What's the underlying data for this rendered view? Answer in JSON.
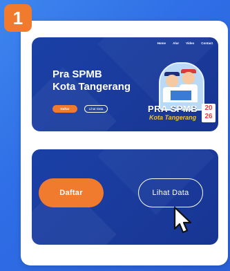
{
  "step": {
    "number": "1"
  },
  "colors": {
    "accent": "#f07a2d",
    "panel": "#1a40a6",
    "background": "#3e86ee",
    "card": "#ffffff"
  },
  "preview": {
    "nav": [
      "Home",
      "Alur",
      "Video",
      "Contact"
    ],
    "title_line1": "Pra SPMB",
    "title_line2": "Kota Tangerang",
    "daftar_label": "Daftar",
    "lihat_label": "Lihat Data",
    "logo": {
      "word1": "PRA SPMB",
      "word2": "Kota Tangerang",
      "year_top": "20",
      "year_bottom": "26"
    }
  },
  "zoom": {
    "daftar_label": "Daftar",
    "lihat_label": "Lihat Data",
    "cursor_icon": "mouse-pointer-icon"
  }
}
